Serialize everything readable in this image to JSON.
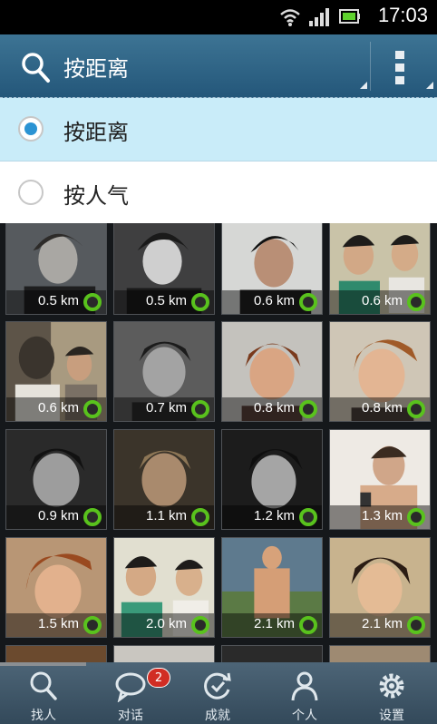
{
  "status_bar": {
    "time": "17:03"
  },
  "action_bar": {
    "title": "按距离"
  },
  "sort_menu": {
    "options": [
      {
        "label": "按距离",
        "selected": true
      },
      {
        "label": "按人气",
        "selected": false
      }
    ]
  },
  "people": [
    {
      "distance": "0.5 km"
    },
    {
      "distance": "0.5 km"
    },
    {
      "distance": "0.6 km"
    },
    {
      "distance": "0.6 km"
    },
    {
      "distance": "0.6 km"
    },
    {
      "distance": "0.7 km"
    },
    {
      "distance": "0.8 km"
    },
    {
      "distance": "0.8 km"
    },
    {
      "distance": "0.9 km"
    },
    {
      "distance": "1.1 km"
    },
    {
      "distance": "1.2 km"
    },
    {
      "distance": "1.3 km"
    },
    {
      "distance": "1.5 km"
    },
    {
      "distance": "2.0 km"
    },
    {
      "distance": "2.1 km"
    },
    {
      "distance": "2.1 km"
    }
  ],
  "bottom_nav": {
    "items": [
      {
        "label": "找人",
        "icon": "search-icon"
      },
      {
        "label": "对话",
        "icon": "chat-icon",
        "badge": "2"
      },
      {
        "label": "成就",
        "icon": "refresh-check-icon"
      },
      {
        "label": "个人",
        "icon": "person-icon"
      },
      {
        "label": "设置",
        "icon": "gear-icon"
      }
    ]
  },
  "colors": {
    "online": "#59c21d",
    "selected_bg": "#c9ecf9",
    "accent": "#2b93d3",
    "action_bar": "#2f6788",
    "badge": "#d12d24"
  }
}
